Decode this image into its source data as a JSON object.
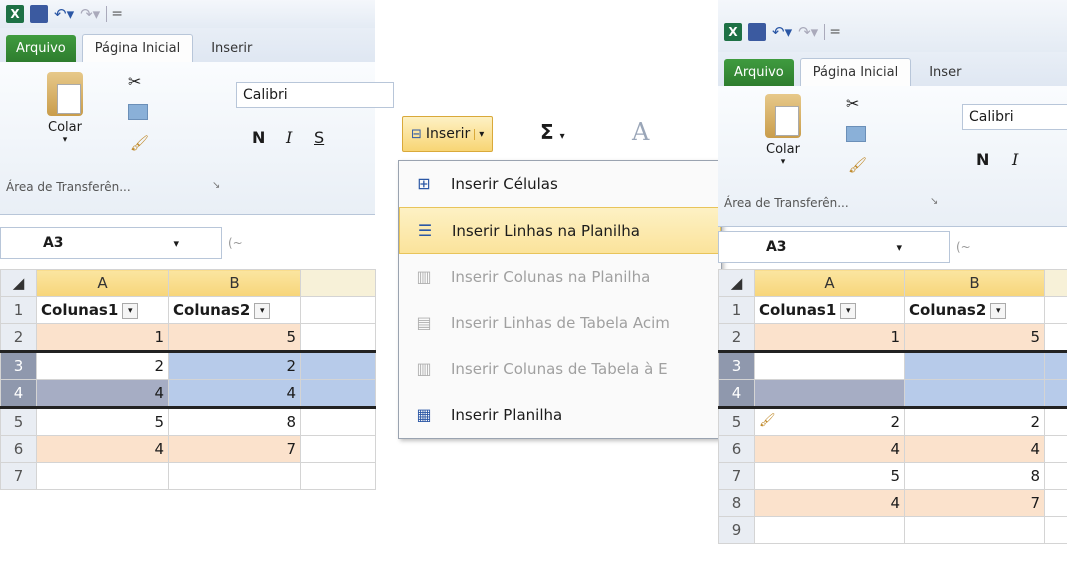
{
  "qat": {
    "excel_icon": "excel-icon",
    "save_icon": "save-icon",
    "undo_icon": "undo-icon",
    "redo_icon": "redo-icon",
    "customize": "="
  },
  "left": {
    "tabs": {
      "file": "Arquivo",
      "home": "Página Inicial",
      "insert": "Inserir"
    },
    "ribbon": {
      "paste": "Colar",
      "font": "Calibri",
      "bold": "N",
      "italic": "I",
      "strike": "S",
      "clipboard_group": "Área de Transferên..."
    },
    "namebox": "A3",
    "columns": [
      "A",
      "B"
    ],
    "rows": [
      {
        "n": "1",
        "a": "Colunas1",
        "b": "Colunas2"
      },
      {
        "n": "2",
        "a": "1",
        "b": "5"
      },
      {
        "n": "3",
        "a": "2",
        "b": "2"
      },
      {
        "n": "4",
        "a": "4",
        "b": "4"
      },
      {
        "n": "5",
        "a": "5",
        "b": "8"
      },
      {
        "n": "6",
        "a": "4",
        "b": "7"
      },
      {
        "n": "7",
        "a": "",
        "b": ""
      }
    ]
  },
  "middle": {
    "insert_button": "Inserir",
    "sum_symbol": "Σ",
    "menu": [
      {
        "label": "Inserir Células",
        "state": "enabled"
      },
      {
        "label": "Inserir Linhas na Planilha",
        "state": "highlighted"
      },
      {
        "label": "Inserir Colunas na Planilha",
        "state": "disabled"
      },
      {
        "label": "Inserir Linhas de Tabela Acim",
        "state": "disabled"
      },
      {
        "label": "Inserir Colunas de Tabela à E",
        "state": "disabled"
      },
      {
        "label": "Inserir Planilha",
        "state": "enabled"
      }
    ]
  },
  "right": {
    "tabs": {
      "file": "Arquivo",
      "home": "Página Inicial",
      "insert": "Inser"
    },
    "ribbon": {
      "paste": "Colar",
      "font": "Calibri",
      "bold": "N",
      "italic": "I",
      "clipboard_group": "Área de Transferên..."
    },
    "namebox": "A3",
    "columns": [
      "A",
      "B"
    ],
    "rows": [
      {
        "n": "1",
        "a": "Colunas1",
        "b": "Colunas2"
      },
      {
        "n": "2",
        "a": "1",
        "b": "5"
      },
      {
        "n": "3",
        "a": "",
        "b": ""
      },
      {
        "n": "4",
        "a": "",
        "b": ""
      },
      {
        "n": "5",
        "a": "2",
        "b": "2"
      },
      {
        "n": "6",
        "a": "4",
        "b": "4"
      },
      {
        "n": "7",
        "a": "5",
        "b": "8"
      },
      {
        "n": "8",
        "a": "4",
        "b": "7"
      },
      {
        "n": "9",
        "a": "",
        "b": ""
      }
    ]
  },
  "colors": {
    "file_tab": "#2e7d2e",
    "band": "#fbe2cc",
    "selection_blue": "#b7cbea",
    "selection_gray": "#a6adc4",
    "menu_highlight": "#fbe39b"
  }
}
